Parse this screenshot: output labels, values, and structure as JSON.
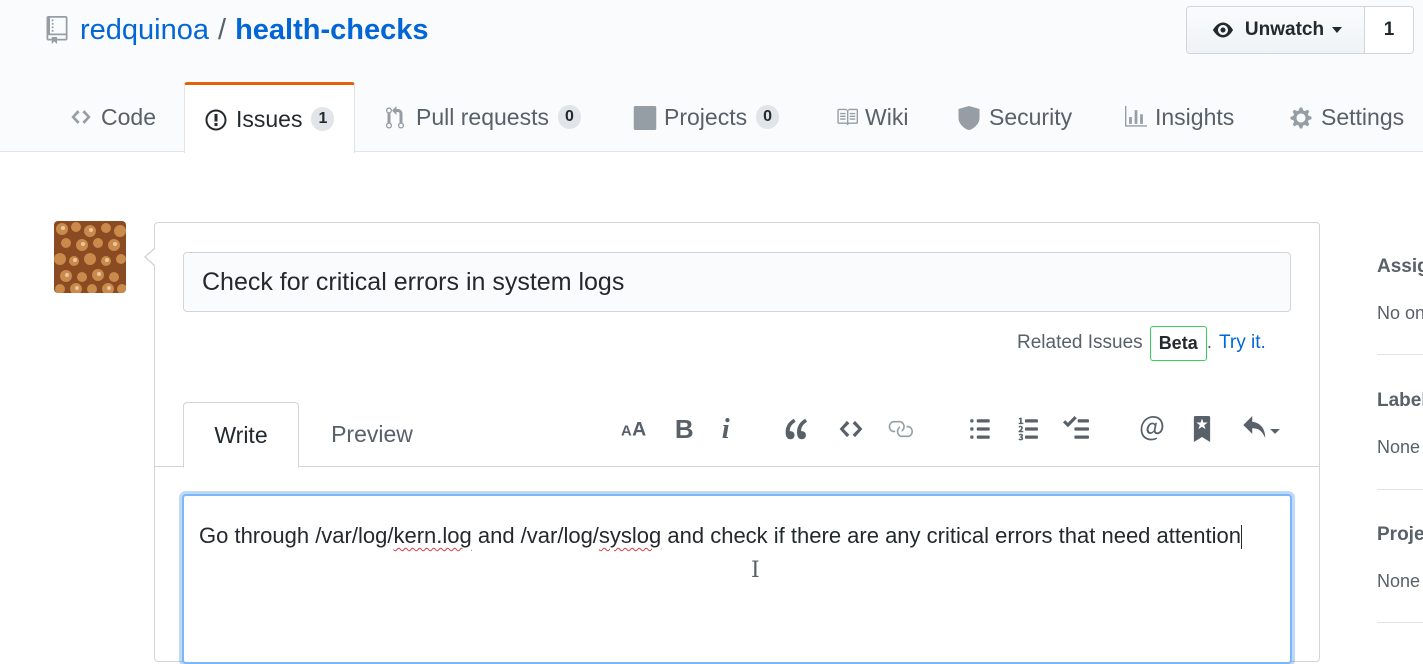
{
  "repo": {
    "owner": "redquinoa",
    "separator": "/",
    "name": "health-checks",
    "icon": "repo-icon"
  },
  "watch": {
    "label": "Unwatch",
    "count": "1",
    "icon": "eye-icon"
  },
  "nav": {
    "tabs": [
      {
        "label": "Code",
        "icon": "code-icon"
      },
      {
        "label": "Issues",
        "counter": "1",
        "icon": "issue-opened-icon"
      },
      {
        "label": "Pull requests",
        "counter": "0",
        "icon": "git-pull-request-icon"
      },
      {
        "label": "Projects",
        "counter": "0",
        "icon": "project-icon"
      },
      {
        "label": "Wiki",
        "icon": "book-icon"
      },
      {
        "label": "Security",
        "icon": "shield-icon"
      },
      {
        "label": "Insights",
        "icon": "graph-icon"
      },
      {
        "label": "Settings",
        "icon": "gear-icon"
      }
    ],
    "selected": "Issues"
  },
  "issue": {
    "title_value": "Check for critical errors in system logs",
    "related_label": "Related Issues",
    "beta_badge": "Beta",
    "dot": ".",
    "try_it": "Try it.",
    "tabs": {
      "write": "Write",
      "preview": "Preview"
    },
    "toolbar": [
      "header-icon",
      "bold-icon",
      "italic-icon",
      "quote-icon",
      "code-icon",
      "link-icon",
      "unordered-list-icon",
      "ordered-list-icon",
      "task-list-icon",
      "mention-icon",
      "reference-icon",
      "reply-icon"
    ],
    "body": {
      "part1": "Go through /var/log/",
      "misspelled1": "kern.log",
      "part2": " and /var/log/",
      "misspelled2": "syslog",
      "part3": " and check if there are any critical errors that need attention"
    }
  },
  "sidebar": {
    "assignees": {
      "heading": "Assignees",
      "value": "No one"
    },
    "labels": {
      "heading": "Labels",
      "value": "None yet"
    },
    "projects": {
      "heading": "Projects",
      "value": "None yet"
    }
  },
  "colors": {
    "link": "#0366d6",
    "selected_tab_accent": "#e36209",
    "focus_border": "#79b8ff",
    "beta_border": "#34d058"
  }
}
